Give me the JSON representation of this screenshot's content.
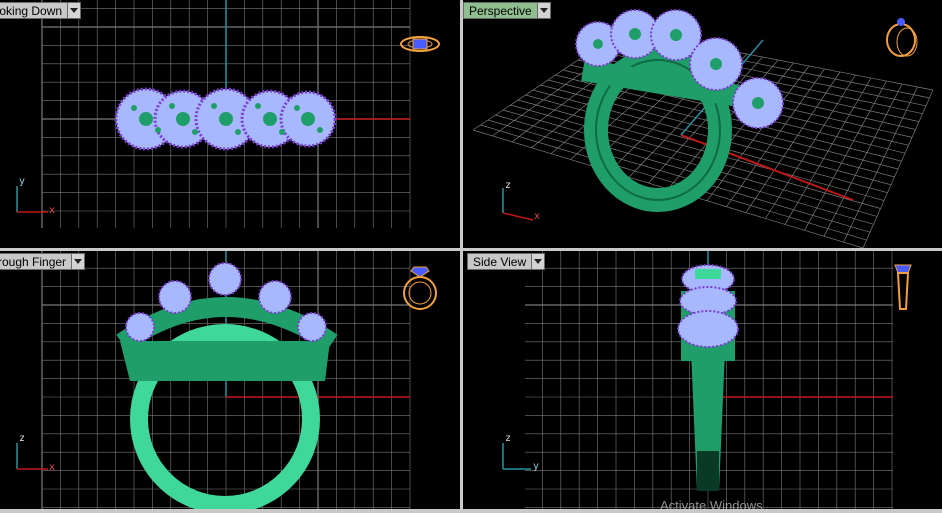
{
  "viewports": {
    "top_left": {
      "title": "Looking Down"
    },
    "top_right": {
      "title": "Perspective"
    },
    "bottom_left": {
      "title": "Through Finger"
    },
    "bottom_right": {
      "title": "Side View"
    }
  },
  "axes": {
    "top_left": {
      "vertical": "y",
      "horizontal": "x"
    },
    "top_right": {
      "vertical": "z",
      "horizontal": "x"
    },
    "bottom_left": {
      "vertical": "z",
      "horizontal": "x"
    },
    "bottom_right": {
      "vertical": "z",
      "horizontal": "y"
    }
  },
  "icons": {
    "view_cube": "ring-view-cube-icon",
    "dropdown": "chevron-down-icon"
  },
  "colors": {
    "background": "#000000",
    "grid": "#7a7a7a",
    "x_axis": "#c01818",
    "y_axis": "#2a8fa0",
    "metal": "#1f9e6a",
    "metal_light": "#3fd79a",
    "gem": "#a8b8ff",
    "gem_accent": "#7a3cd0",
    "active_tab": "#8fbf8f",
    "view_cube": "#f0a040"
  },
  "watermark": "Activate Windows"
}
